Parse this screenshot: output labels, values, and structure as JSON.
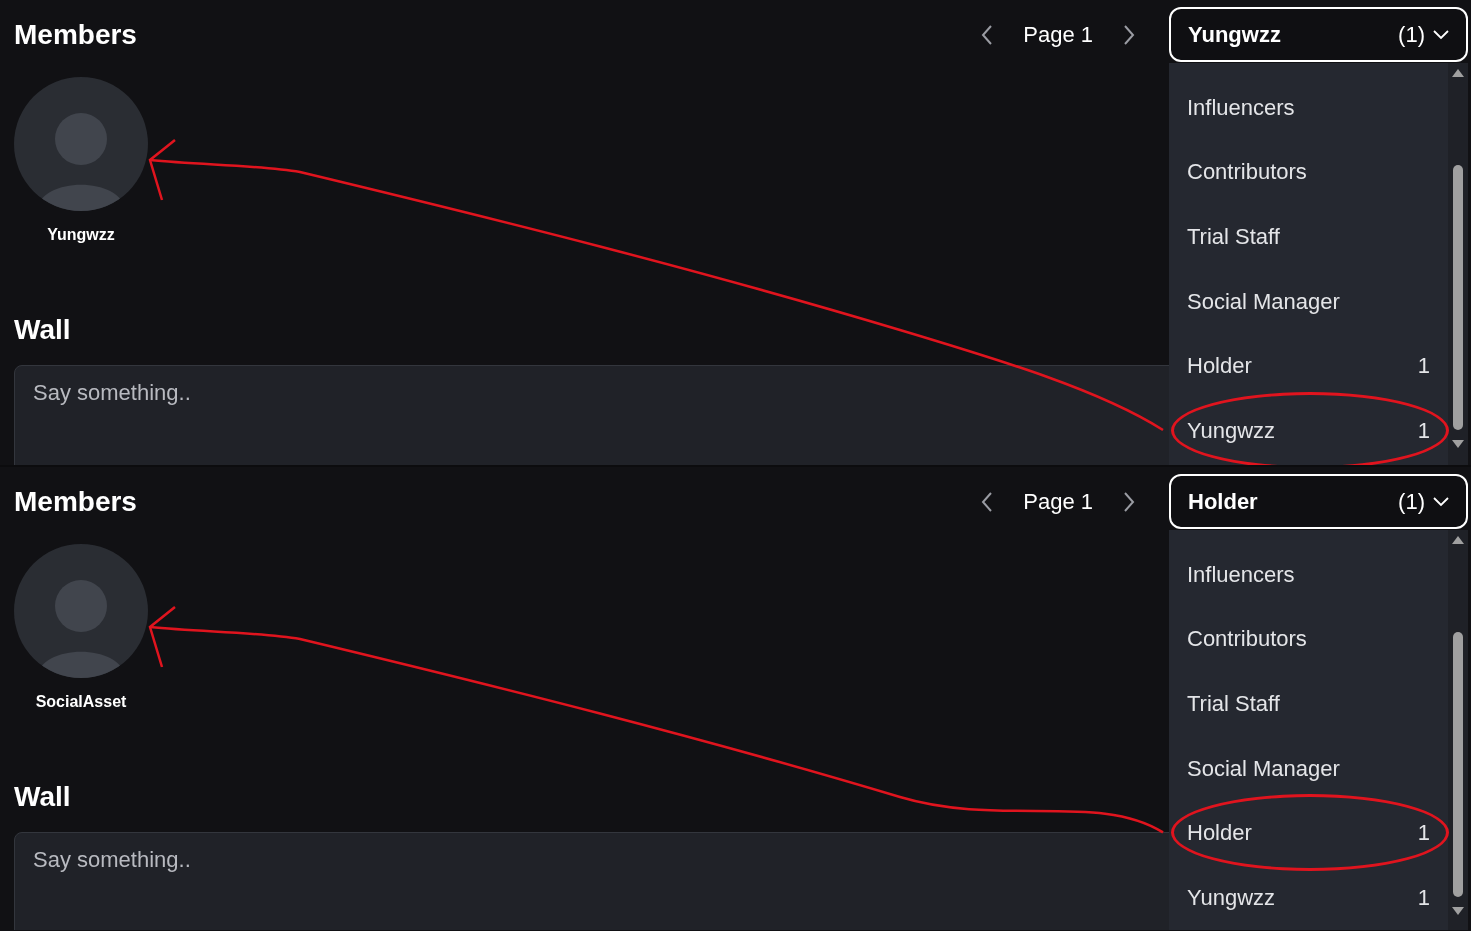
{
  "panels": [
    {
      "members_title": "Members",
      "pager": {
        "label": "Page 1"
      },
      "dropdown": {
        "value": "Yungwzz",
        "count": "(1)",
        "options": [
          {
            "label": "Influencers",
            "circled": false
          },
          {
            "label": "Contributors",
            "circled": false
          },
          {
            "label": "Trial Staff",
            "circled": false
          },
          {
            "label": "Social Manager",
            "circled": false
          },
          {
            "label": "Holder",
            "count": "1",
            "circled": false
          },
          {
            "label": "Yungwzz",
            "count": "1",
            "circled": true
          }
        ]
      },
      "members": [
        {
          "name": "Yungwzz"
        }
      ],
      "wall_title": "Wall",
      "wall_input": {
        "placeholder": "Say something.."
      }
    },
    {
      "members_title": "Members",
      "pager": {
        "label": "Page 1"
      },
      "dropdown": {
        "value": "Holder",
        "count": "(1)",
        "options": [
          {
            "label": "Influencers",
            "circled": false
          },
          {
            "label": "Contributors",
            "circled": false
          },
          {
            "label": "Trial Staff",
            "circled": false
          },
          {
            "label": "Social Manager",
            "circled": false
          },
          {
            "label": "Holder",
            "count": "1",
            "circled": true
          },
          {
            "label": "Yungwzz",
            "count": "1",
            "circled": false
          }
        ]
      },
      "members": [
        {
          "name": "SocialAsset"
        }
      ],
      "wall_title": "Wall",
      "wall_input": {
        "placeholder": "Say something.."
      }
    }
  ]
}
